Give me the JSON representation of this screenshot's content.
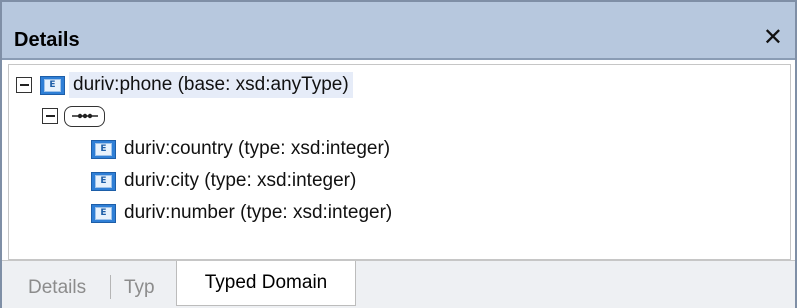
{
  "panel": {
    "title": "Details",
    "close_glyph": "✕"
  },
  "tree": {
    "root": {
      "icon": "element-icon",
      "icon_letter": "E",
      "label": "duriv:phone (base: xsd:anyType)",
      "expanded": true
    },
    "compositor": {
      "icon": "sequence-compositor-icon",
      "expanded": true
    },
    "children": [
      {
        "icon": "element-icon",
        "icon_letter": "E",
        "label": "duriv:country (type: xsd:integer)"
      },
      {
        "icon": "element-icon",
        "icon_letter": "E",
        "label": "duriv:city (type: xsd:integer)"
      },
      {
        "icon": "element-icon",
        "icon_letter": "E",
        "label": "duriv:number (type: xsd:integer)"
      }
    ]
  },
  "tabs": [
    {
      "label": "Details",
      "active": false
    },
    {
      "label": "Typ",
      "active": false
    },
    {
      "label": "Typed Domain",
      "active": true
    }
  ],
  "colors": {
    "titlebar": "#b7c8de",
    "element_icon": "#2f7fd6",
    "selection": "#e6ecf8"
  }
}
